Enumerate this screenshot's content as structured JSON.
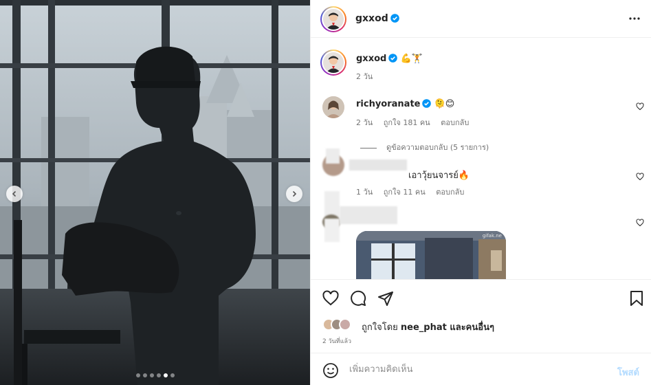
{
  "post": {
    "author": "gxxod",
    "more_icon": "more-horizontal-icon",
    "caption_emojis": "💪🏋"
  },
  "caption": {
    "author": "gxxod",
    "time": "2 วัน"
  },
  "comments": [
    {
      "username": "richyoranate",
      "emojis": "🫠😊",
      "time": "2 วัน",
      "likes": "ถูกใจ 181 คน",
      "reply": "ตอบกลับ"
    },
    {
      "username": "",
      "text": "เอาวุ้ยนจารย์🔥",
      "time": "1 วัน",
      "likes": "ถูกใจ 11 คน",
      "reply": "ตอบกลับ"
    }
  ],
  "view_replies": "ดูข้อความตอบกลับ (5 รายการ)",
  "likes_summary": {
    "prefix": "ถูกใจโดย ",
    "user": "nee_phat",
    "suffix": " และคนอื่นๆ"
  },
  "post_time": "2 วันที่แล้ว",
  "composer": {
    "placeholder": "เพิ่มความคิดเห็น",
    "post_label": "โพสต์"
  },
  "carousel": {
    "count": 6,
    "active_index": 4
  },
  "colors": {
    "verified": "#0095f6",
    "post_disabled": "#b3dbff"
  },
  "gif_watermark": "gifak.ne"
}
